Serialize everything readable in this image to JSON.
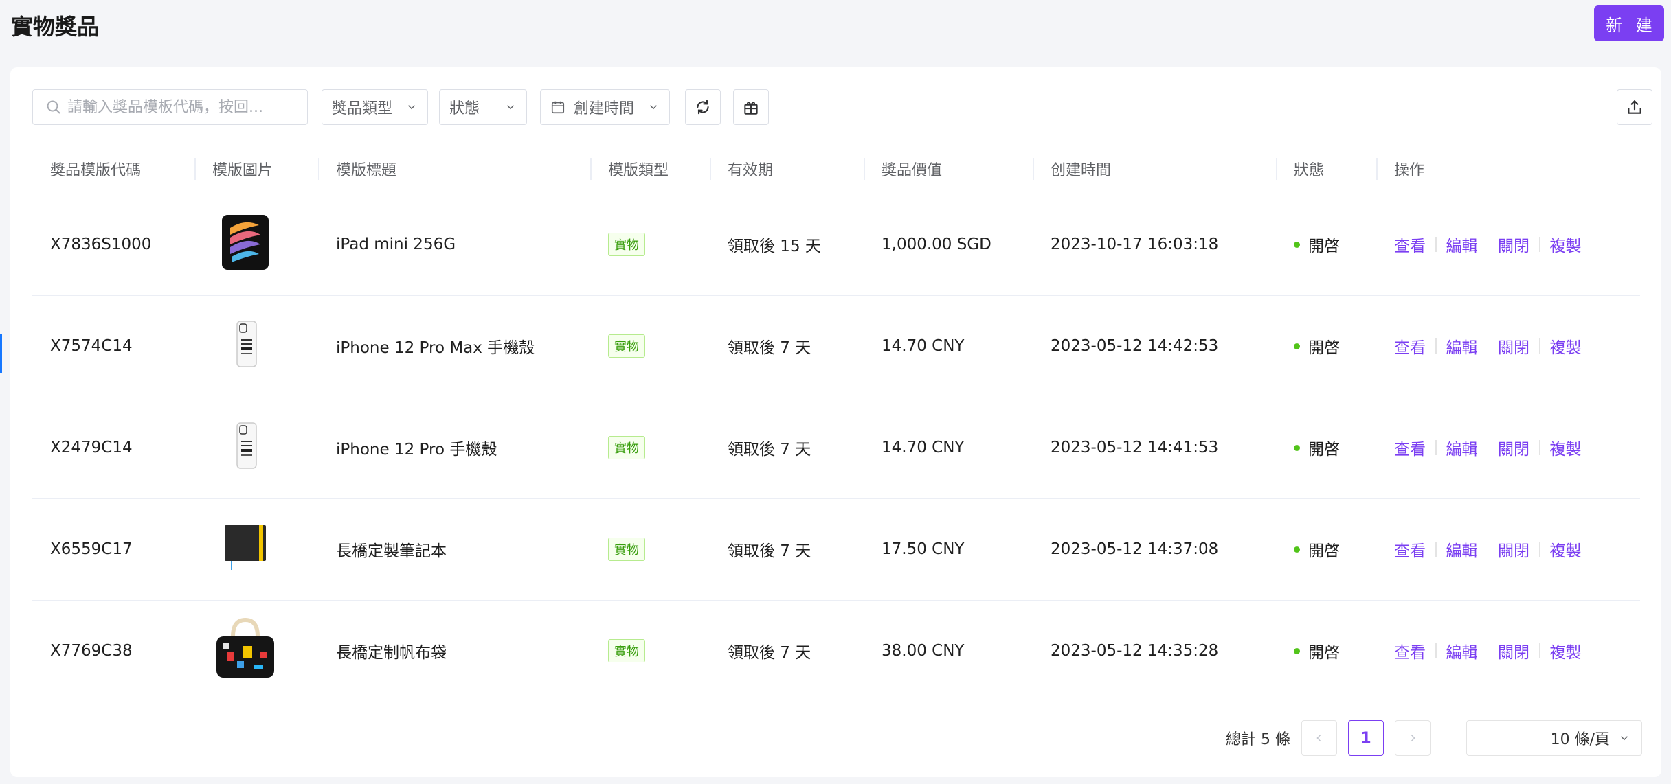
{
  "page": {
    "title": "實物獎品",
    "new_button": "新 建"
  },
  "toolbar": {
    "search_placeholder": "請輸入獎品模板代碼，按回...",
    "type_filter": "獎品類型",
    "status_filter": "狀態",
    "date_filter": "創建時間"
  },
  "table": {
    "headers": [
      "獎品模版代碼",
      "模版圖片",
      "模版標題",
      "模版類型",
      "有效期",
      "獎品價值",
      "创建時間",
      "狀態",
      "操作"
    ],
    "rows": [
      {
        "code": "X7836S1000",
        "image": "ipad-image",
        "title": "iPad mini 256G",
        "type": "實物",
        "validity": "領取後 15 天",
        "value": "1,000.00 SGD",
        "created": "2023-10-17 16:03:18",
        "status": "開啓"
      },
      {
        "code": "X7574C14",
        "image": "phone-case-image",
        "title": "iPhone 12 Pro Max 手機殼",
        "type": "實物",
        "validity": "領取後 7 天",
        "value": "14.70 CNY",
        "created": "2023-05-12 14:42:53",
        "status": "開啓"
      },
      {
        "code": "X2479C14",
        "image": "phone-case-image",
        "title": "iPhone 12 Pro 手機殼",
        "type": "實物",
        "validity": "領取後 7 天",
        "value": "14.70 CNY",
        "created": "2023-05-12 14:41:53",
        "status": "開啓"
      },
      {
        "code": "X6559C17",
        "image": "notebook-image",
        "title": "長橋定製筆記本",
        "type": "實物",
        "validity": "領取後 7 天",
        "value": "17.50 CNY",
        "created": "2023-05-12 14:37:08",
        "status": "開啓"
      },
      {
        "code": "X7769C38",
        "image": "tote-bag-image",
        "title": "長橋定制帆布袋",
        "type": "實物",
        "validity": "領取後 7 天",
        "value": "38.00 CNY",
        "created": "2023-05-12 14:35:28",
        "status": "開啓"
      }
    ],
    "actions": [
      "查看",
      "編輯",
      "關閉",
      "複製"
    ]
  },
  "pagination": {
    "total": "總計 5 條",
    "current_page": "1",
    "page_size": "10 條/頁"
  },
  "colors": {
    "accent": "#7b3ff2",
    "status_green": "#52c41a",
    "tag_green": "#389e0d"
  }
}
